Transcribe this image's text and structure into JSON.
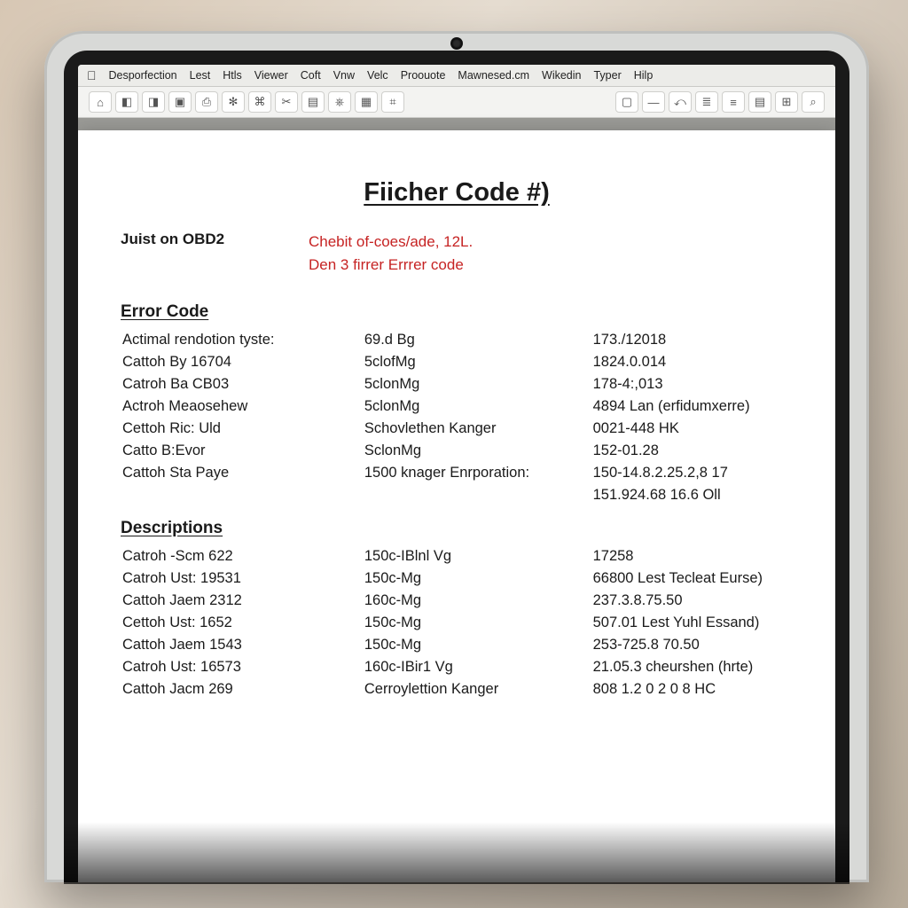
{
  "menubar": {
    "items": [
      "Desporfection",
      "Lest",
      "Htls",
      "Viewer",
      "Coft",
      "Vnw",
      "Velc",
      "Proouote",
      "Mawnesed.cm",
      "Wikedin",
      "Typer",
      "Hilp"
    ]
  },
  "toolbar": {
    "left_icons": [
      "⌂",
      "◧",
      "◨",
      "▣",
      "⎙",
      "✻",
      "⌘",
      "✂",
      "▤",
      "⎈",
      "▦",
      "⌗"
    ],
    "right_icons": [
      "▢",
      "—",
      "⤺",
      "≣",
      "≡",
      "▤",
      "⊞",
      "⌕"
    ]
  },
  "document": {
    "title": "Fiicher Code #)",
    "meta_label": "Juist on OBD2",
    "red_line1": "Chebit of-coes/ade, 12L.",
    "red_line2": "Den 3 firrer Errrer code",
    "section_error": "Error Code",
    "error_rows": [
      {
        "c1": "Actimal rendotion tyste:",
        "c2": "69.d Bg",
        "c3": "173./12018"
      },
      {
        "c1": "Cattoh By 16704",
        "c2": "5clofMg",
        "c3": "1824.0.014"
      },
      {
        "c1": "Catroh Ba CB03",
        "c2": "5clonMg",
        "c3": "178-4:,013"
      },
      {
        "c1": "Actroh Meaosehew",
        "c2": "5clonMg",
        "c3": "4894 Lan (erfidumxerre)"
      },
      {
        "c1": "Cettoh Ric: Uld",
        "c2": "Schovlethen Kanger",
        "c3": "0021-448 HK"
      },
      {
        "c1": "Catto B:Evor",
        "c2": "SclonMg",
        "c3": "152-01.28"
      },
      {
        "c1": "Cattoh Sta Paye",
        "c2": "1500 knager Enrporation:",
        "c3": "150-14.8.2.25.2,8 17"
      },
      {
        "c1": "",
        "c2": "",
        "c3": "151.924.68  16.6 Oll"
      }
    ],
    "section_desc": "Descriptions",
    "desc_rows": [
      {
        "c1": "Catroh -Scm 622",
        "c2": "150c-IBlnl Vg",
        "c3": "17258"
      },
      {
        "c1": "Catroh Ust: 19531",
        "c2": "150c-Mg",
        "c3": "66800 Lest Tecleat Eurse)"
      },
      {
        "c1": "Cattoh Jaem 2312",
        "c2": "160c-Mg",
        "c3": "237.3.8.75.50"
      },
      {
        "c1": "Cettoh Ust: 1652",
        "c2": "150c-Mg",
        "c3": "507.01 Lest Yuhl Essand)"
      },
      {
        "c1": "Cattoh Jaem 1543",
        "c2": "150c-Mg",
        "c3": "253-725.8 70.50"
      },
      {
        "c1": "Catroh Ust: 16573",
        "c2": "160c-IBir1 Vg",
        "c3": "21.05.3 cheurshen (hrte)"
      },
      {
        "c1": "Cattoh Jacm 269",
        "c2": "Cerroylettion Kanger",
        "c3": "808 1.2 0 2 0 8 HC"
      }
    ]
  }
}
